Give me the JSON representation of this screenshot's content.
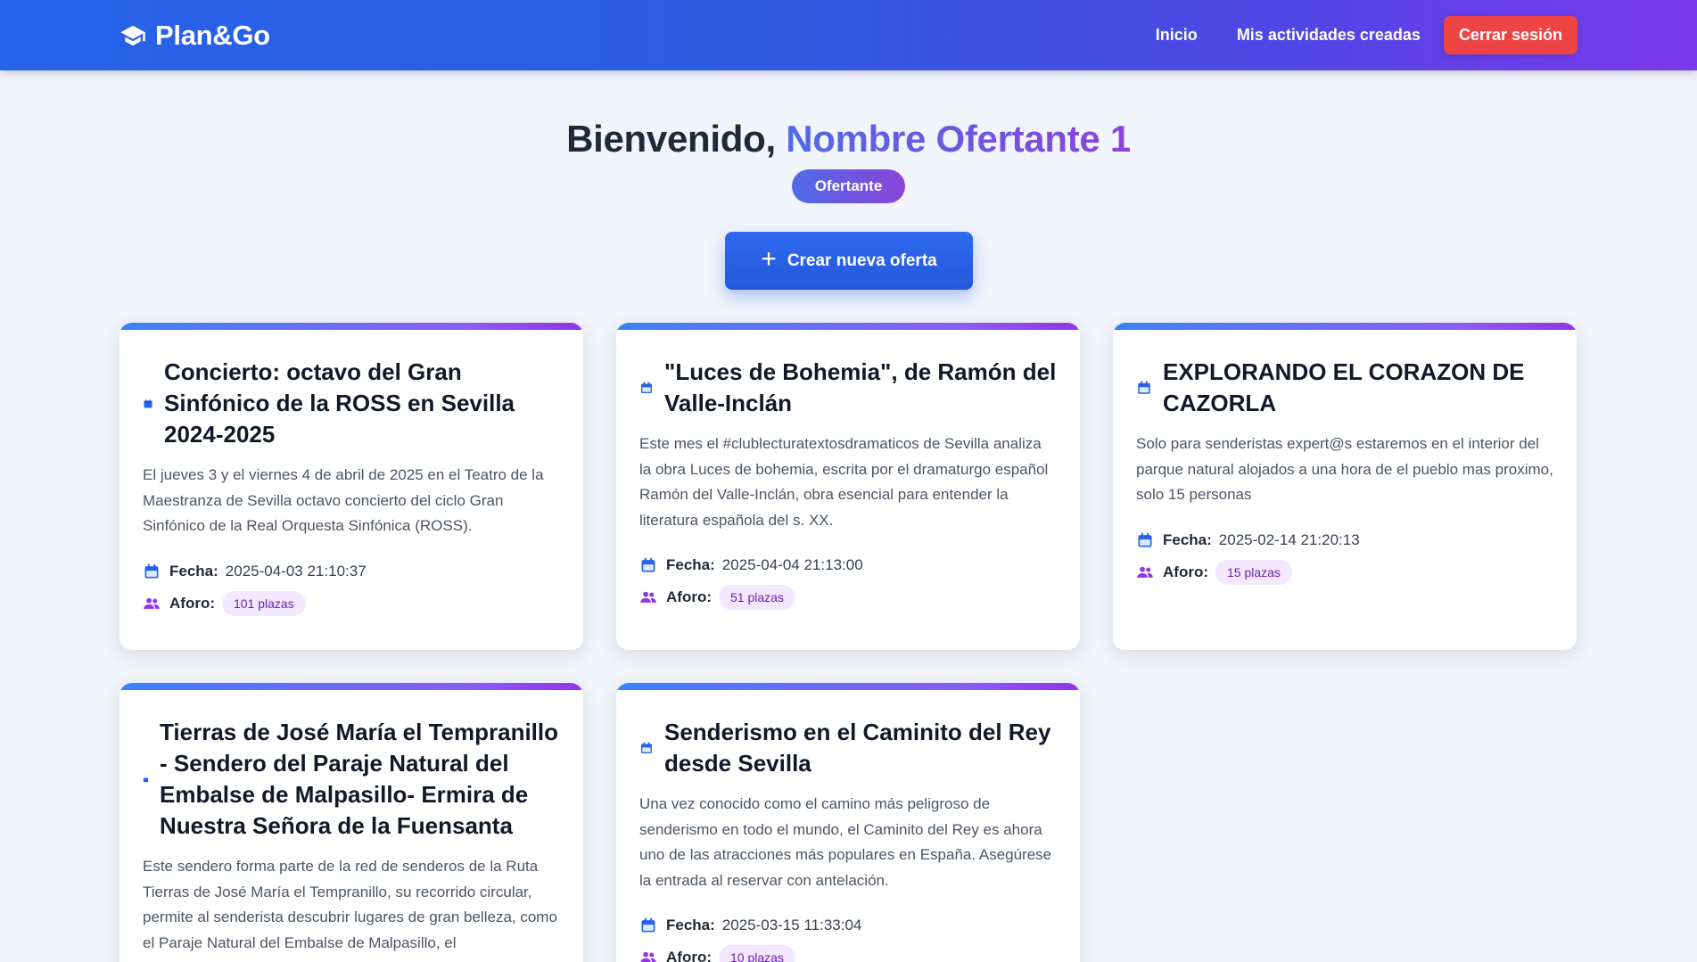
{
  "navbar": {
    "brand": "Plan&Go",
    "links": [
      {
        "label": "Inicio"
      },
      {
        "label": "Mis actividades creadas"
      }
    ],
    "logout_label": "Cerrar sesión"
  },
  "hero": {
    "welcome_prefix": "Bienvenido, ",
    "user_name": "Nombre Ofertante 1",
    "role": "Ofertante",
    "create_button": "Crear nueva oferta"
  },
  "labels": {
    "fecha": "Fecha:",
    "aforo": "Aforo:"
  },
  "colors": {
    "accent": "#2563eb",
    "purple": "#7c3aed",
    "danger": "#ef4444",
    "pill_bg": "#f3e8ff"
  },
  "activities": [
    {
      "title": "Concierto: octavo del Gran Sinfónico de la ROSS en Sevilla 2024-2025",
      "description": "El jueves 3 y el viernes 4 de abril de 2025 en el Teatro de la Maestranza de Sevilla octavo concierto del ciclo Gran Sinfónico de la Real Orquesta Sinfónica (ROSS).",
      "fecha": "2025-04-03 21:10:37",
      "aforo": "101 plazas"
    },
    {
      "title": "\"Luces de Bohemia\", de Ramón del Valle-Inclán",
      "description": "Este mes el #clublecturatextosdramaticos de Sevilla analiza la obra Luces de bohemia, escrita por el dramaturgo español Ramón del Valle-Inclán, obra esencial para entender la literatura española del s. XX.",
      "fecha": "2025-04-04 21:13:00",
      "aforo": "51 plazas"
    },
    {
      "title": "EXPLORANDO EL CORAZON DE CAZORLA",
      "description": "Solo para senderistas expert@s estaremos en el interior del parque natural alojados a una hora de el pueblo mas proximo, solo 15 personas",
      "fecha": "2025-02-14 21:20:13",
      "aforo": "15 plazas"
    },
    {
      "title": "Tierras de José María el Tempranillo - Sendero del Paraje Natural del Embalse de Malpasillo- Ermira de Nuestra Señora de la Fuensanta",
      "description": "Este sendero forma parte de la red de senderos de la Ruta Tierras de José María el Tempranillo, su recorrido circular, permite al senderista descubrir lugares de gran belleza, como el Paraje Natural del Embalse de Malpasillo, el",
      "fecha": "",
      "aforo": ""
    },
    {
      "title": "Senderismo en el Caminito del Rey desde Sevilla",
      "description": "Una vez conocido como el camino más peligroso de senderismo en todo el mundo, el Caminito del Rey es ahora uno de las atracciones más populares en España. Asegúrese la entrada al reservar con antelación.",
      "fecha": "2025-03-15 11:33:04",
      "aforo": "10 plazas"
    }
  ]
}
